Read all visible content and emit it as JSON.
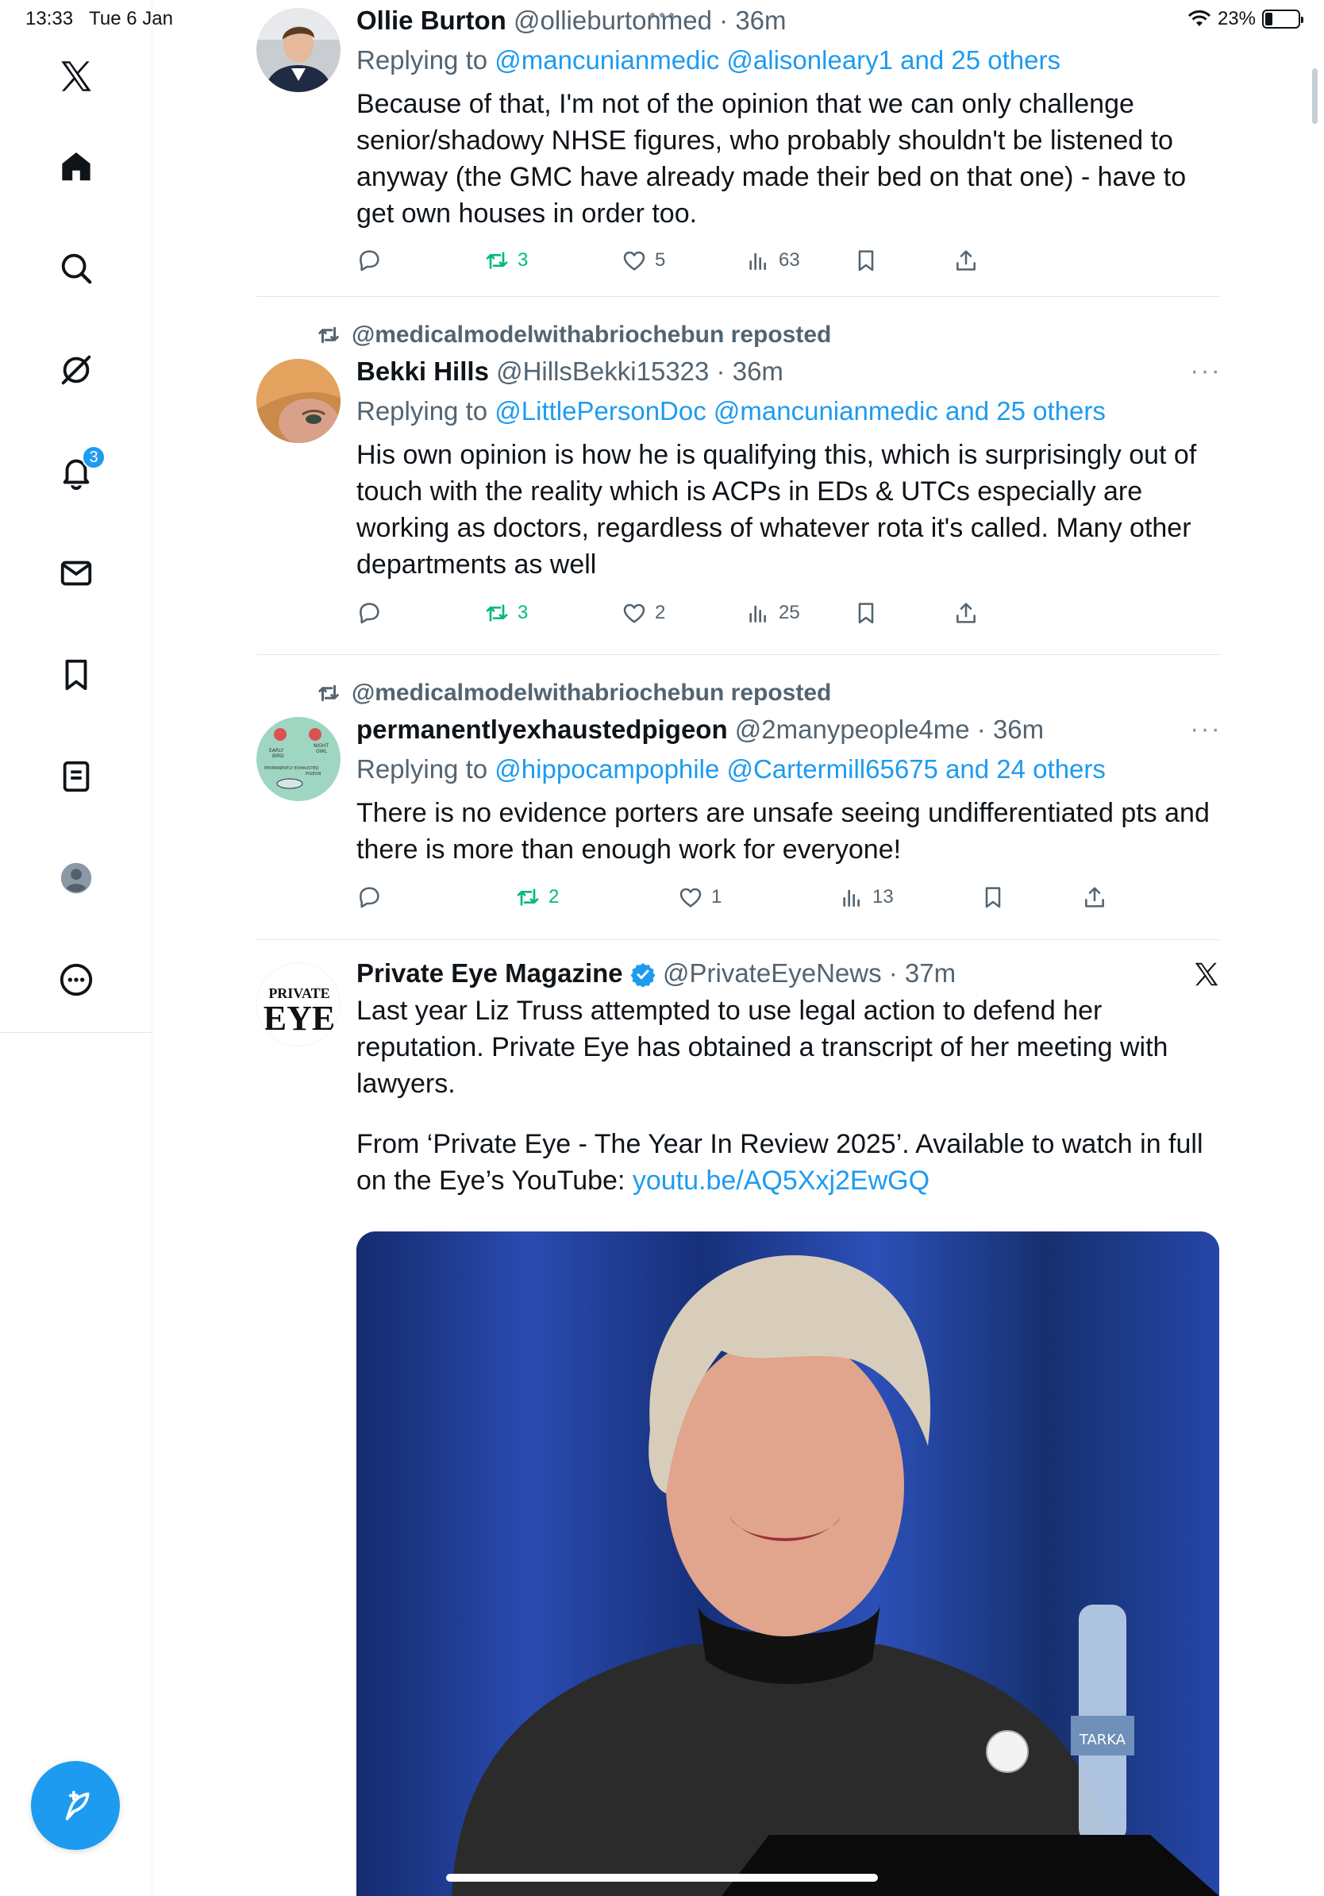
{
  "status": {
    "time": "13:33",
    "date": "Tue 6 Jan",
    "battery": "23%",
    "battery_level": 0.23
  },
  "sidebar": {
    "logo": "x-logo-icon",
    "items": [
      {
        "name": "home-icon"
      },
      {
        "name": "search-icon"
      },
      {
        "name": "grok-icon"
      },
      {
        "name": "bell-icon",
        "badge": "3"
      },
      {
        "name": "mail-icon"
      },
      {
        "name": "bookmark-icon"
      },
      {
        "name": "lists-icon"
      },
      {
        "name": "profile-icon"
      },
      {
        "name": "more-icon"
      }
    ],
    "compose": "compose-icon"
  },
  "tweets": [
    {
      "name": "Ollie Burton",
      "handle": "@ollieburtonmed",
      "time": "36m",
      "replying_prefix": "Replying to",
      "replying_users": "@mancunianmedic @alisonleary1 and 25 others",
      "text": "Because of that, I'm not of the opinion that we can only challenge senior/shadowy NHSE figures, who probably shouldn't be listened to anyway (the GMC have already made their bed on that one) - have to get own houses in order too.",
      "replies": "",
      "reposts": "3",
      "likes": "5",
      "views": "63"
    },
    {
      "reposted_by": "@medicalmodelwithabriochebun reposted",
      "name": "Bekki Hills",
      "handle": "@HillsBekki15323",
      "time": "36m",
      "replying_prefix": "Replying to",
      "replying_users": "@LittlePersonDoc @mancunianmedic and 25 others",
      "text": "His own opinion is how he is qualifying this, which is surprisingly out of touch with the reality which is ACPs in EDs & UTCs especially are working as doctors, regardless of whatever rota it's called. Many other departments as well",
      "reposts": "3",
      "likes": "2",
      "views": "25"
    },
    {
      "reposted_by": "@medicalmodelwithabriochebun reposted",
      "name": "permanentlyexhaustedpigeon",
      "handle": "@2manypeople4me",
      "time": "36m",
      "replying_prefix": "Replying to",
      "replying_users": "@hippocampophile @Cartermill65675 and 24 others",
      "text": "There is no evidence porters are unsafe seeing undifferentiated pts and there is more than enough work for everyone!",
      "avatar_lines": [
        "EARLY",
        "BIRD",
        "NIGHT",
        "OWL",
        "PERMANENTLY EXHAUSTED",
        "PIGEON"
      ],
      "reposts": "2",
      "likes": "1",
      "views": "13"
    },
    {
      "name": "Private Eye Magazine",
      "handle": "@PrivateEyeNews",
      "time": "37m",
      "avatar_text_top": "PRIVATE",
      "avatar_text_bottom": "EYE",
      "text_p1": "Last year Liz Truss attempted to use legal action to defend her reputation. Private Eye has obtained a transcript of her meeting with lawyers.",
      "text_p2": "From ‘Private Eye - The Year In Review 2025’.  Available to watch in full on the Eye’s YouTube: ",
      "link": "youtu.be/AQ5Xxj2EwGQ",
      "media_badge_text": "TARKA"
    }
  ],
  "colors": {
    "accent": "#1d9bf0",
    "repost_green": "#00ba7c",
    "secondary_text": "#536471"
  }
}
